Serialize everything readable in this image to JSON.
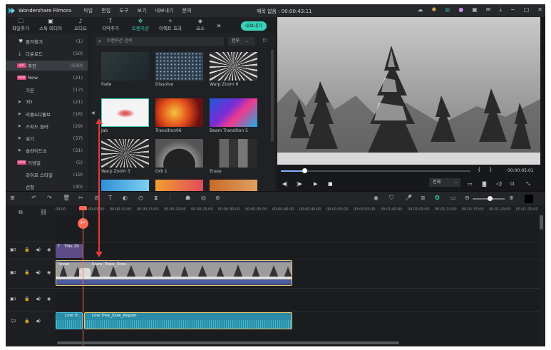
{
  "app": {
    "name": "Wondershare Filmora",
    "title": "제목 없음 : 00:00:43:11",
    "menu": [
      "파일",
      "편집",
      "도구",
      "보기",
      "내보내기",
      "문의"
    ]
  },
  "toolbar": {
    "tabs": [
      "파일추가",
      "스톡 미디어",
      "오디오",
      "자막추가",
      "트랜지션",
      "이펙트 효과",
      "요소"
    ],
    "export_label": "내보내기"
  },
  "sidebar": {
    "items": [
      {
        "label": "즐겨찾기",
        "count": "(1)",
        "icon": "heart-icon"
      },
      {
        "label": "다운로드",
        "count": "(50)",
        "icon": "download-icon"
      },
      {
        "label": "추천",
        "count": "(500)",
        "badge": "HOT"
      },
      {
        "label": "New",
        "count": "(21)",
        "badge": "NEW"
      },
      {
        "label": "기본",
        "count": "(17)"
      },
      {
        "label": "3D",
        "count": "(21)",
        "arrow": true
      },
      {
        "label": "리플&디졸브",
        "count": "(16)",
        "arrow": true
      },
      {
        "label": "스피드 블러",
        "count": "(29)",
        "arrow": true
      },
      {
        "label": "워기",
        "count": "(37)",
        "arrow": true
      },
      {
        "label": "슬라이드쇼",
        "count": "(31)",
        "arrow": true
      },
      {
        "label": "기념일",
        "count": "(5)",
        "badge": "NEW"
      },
      {
        "label": "라이프 스타일",
        "count": "(19)"
      },
      {
        "label": "선형",
        "count": "(30)"
      }
    ]
  },
  "library": {
    "search_placeholder": "트랜지션 검색",
    "filter": "전부",
    "items": [
      "Fade",
      "Dissolve",
      "Warp Zoom 6",
      "Jab",
      "Transition06",
      "Beam Transition 5",
      "Warp Zoom 3",
      "Orb 1",
      "Erase"
    ]
  },
  "preview": {
    "time": "00:00:05:01",
    "quality": "전체"
  },
  "timeline": {
    "ruler": [
      "00:00",
      "00:00:05:00",
      "00:00:10:00",
      "00:00:15:00",
      "00:00:20:00",
      "00:00:25:00",
      "00:00:30:00",
      "00:00:35:00",
      "00:00:40:00",
      "00:00:45:00",
      "00:00:50:00",
      "00:00:55:00",
      "00:01:00:00",
      "00:01:05:00",
      "00:01:10:00",
      "00:01:15:00",
      "00:01:20:00",
      "00:01:25:00"
    ],
    "tracks": [
      "3",
      "2",
      "1",
      "1"
    ],
    "clips": {
      "title": "Title 29",
      "video1": "Snow",
      "video2": "Snow_Trees_Slow...",
      "audio1": "Line Tr...",
      "audio2": "Line Tree_Slow_Region"
    }
  },
  "colors": {
    "accent": "#39d3b9",
    "playhead": "#ff6a52",
    "hot": "#e0457a",
    "video_clip": "#3d4c79",
    "audio_clip": "#2a8ca6",
    "title_clip": "#5b4b86"
  }
}
